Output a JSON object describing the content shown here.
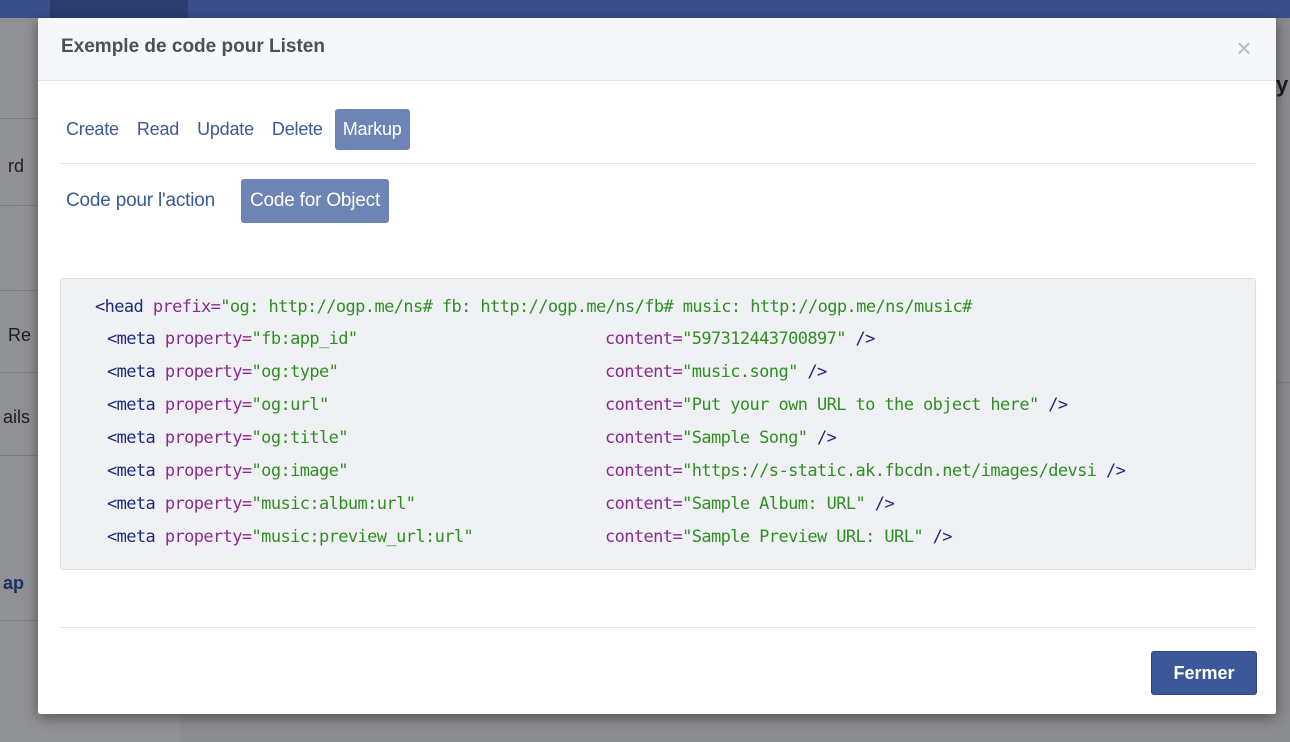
{
  "background": {
    "fragments": [
      "rd",
      "Re",
      "ails",
      "ap"
    ],
    "right_fragment": "y"
  },
  "dialog": {
    "title": "Exemple de code pour Listen",
    "close_glyph": "×",
    "operation_tabs": [
      "Create",
      "Read",
      "Update",
      "Delete",
      "Markup"
    ],
    "active_operation": "Markup",
    "code_tabs": [
      "Code pour l'action",
      "Code for Object"
    ],
    "active_code_tab": "Code for Object",
    "code": {
      "head_open": "<head",
      "head_prefix_attr": " prefix=",
      "head_prefix_value": "\"og: http://ogp.me/ns# fb: http://ogp.me/ns/fb# music: http://ogp.me/ns/music#",
      "meta_tag": "<meta",
      "property_attr": " property=",
      "content_attr": "content=",
      "self_close": " />",
      "metas": [
        {
          "property": "\"fb:app_id\"",
          "content": "\"597312443700897\""
        },
        {
          "property": "\"og:type\"",
          "content": "\"music.song\""
        },
        {
          "property": "\"og:url\"",
          "content": "\"Put your own URL to the object here\""
        },
        {
          "property": "\"og:title\"",
          "content": "\"Sample Song\""
        },
        {
          "property": "\"og:image\"",
          "content": "\"https://s-static.ak.fbcdn.net/images/devsi"
        },
        {
          "property": "\"music:album:url\"",
          "content": "\"Sample Album: URL\""
        },
        {
          "property": "\"music:preview_url:url\"",
          "content": "\"Sample Preview URL: URL\""
        }
      ]
    },
    "close_button_label": "Fermer"
  },
  "colors": {
    "brand_blue": "#3b5998",
    "active_tab": "#6d84b4",
    "tag": "#1d2a7a",
    "attribute": "#8a2a8f",
    "string": "#2f8f22"
  }
}
